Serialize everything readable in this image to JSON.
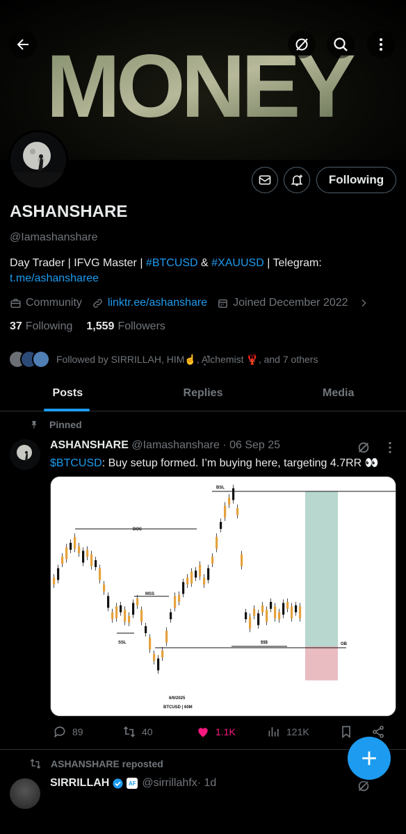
{
  "banner": {
    "word": "MONEY"
  },
  "profile": {
    "display_name": "ASHANSHARE",
    "handle": "@Iamashanshare",
    "bio_prefix": "Day Trader | IFVG Master | ",
    "bio_tag1": "#BTCUSD",
    "bio_and": " & ",
    "bio_tag2": "#XAUUSD",
    "bio_telegram": " | Telegram: ",
    "bio_link": "t.me/ashansharee",
    "category": "Community",
    "website": "linktr.ee/ashanshare",
    "joined": "Joined December 2022",
    "following_count": "37",
    "following_label": "Following",
    "followers_count": "1,559",
    "followers_label": "Followers",
    "followed_by": "Followed by SIRRILLAH, HIM☝️, A͓̽lchemist 🦞, and 7 others"
  },
  "buttons": {
    "follow_label": "Following"
  },
  "tabs": [
    {
      "label": "Posts"
    },
    {
      "label": "Replies"
    },
    {
      "label": "Media"
    }
  ],
  "post": {
    "pinned_label": "Pinned",
    "author": "ASHANSHARE",
    "handle": "@Iamashanshare",
    "date": " · 06 Sep 25",
    "cashtag": "$BTCUSD",
    "text": ": Buy setup formed. I’m buying here, targeting 4.7RR 👀",
    "replies": "89",
    "reposts": "40",
    "likes": "1.1K",
    "views": "121K",
    "chart": {
      "bsl": "BSL",
      "bos": "BOS",
      "mss": "MSS",
      "ssl": "SSL",
      "sss": "$$$",
      "ob": "OB",
      "date": "6/9/2025",
      "pair": "BTCUSD | 60M"
    }
  },
  "repost": {
    "label": "ASHANSHARE reposted",
    "author": "SIRRILLAH",
    "badge": "AF",
    "handle": "@sirrillahfx",
    "time": " · 1d"
  },
  "colors": {
    "accent": "#1d9bf0",
    "like": "#f91880",
    "muted": "#71767b",
    "tp_zone": "#b7d7cf",
    "sl_zone": "#e9bcc2",
    "candle": "#e6a23c"
  }
}
